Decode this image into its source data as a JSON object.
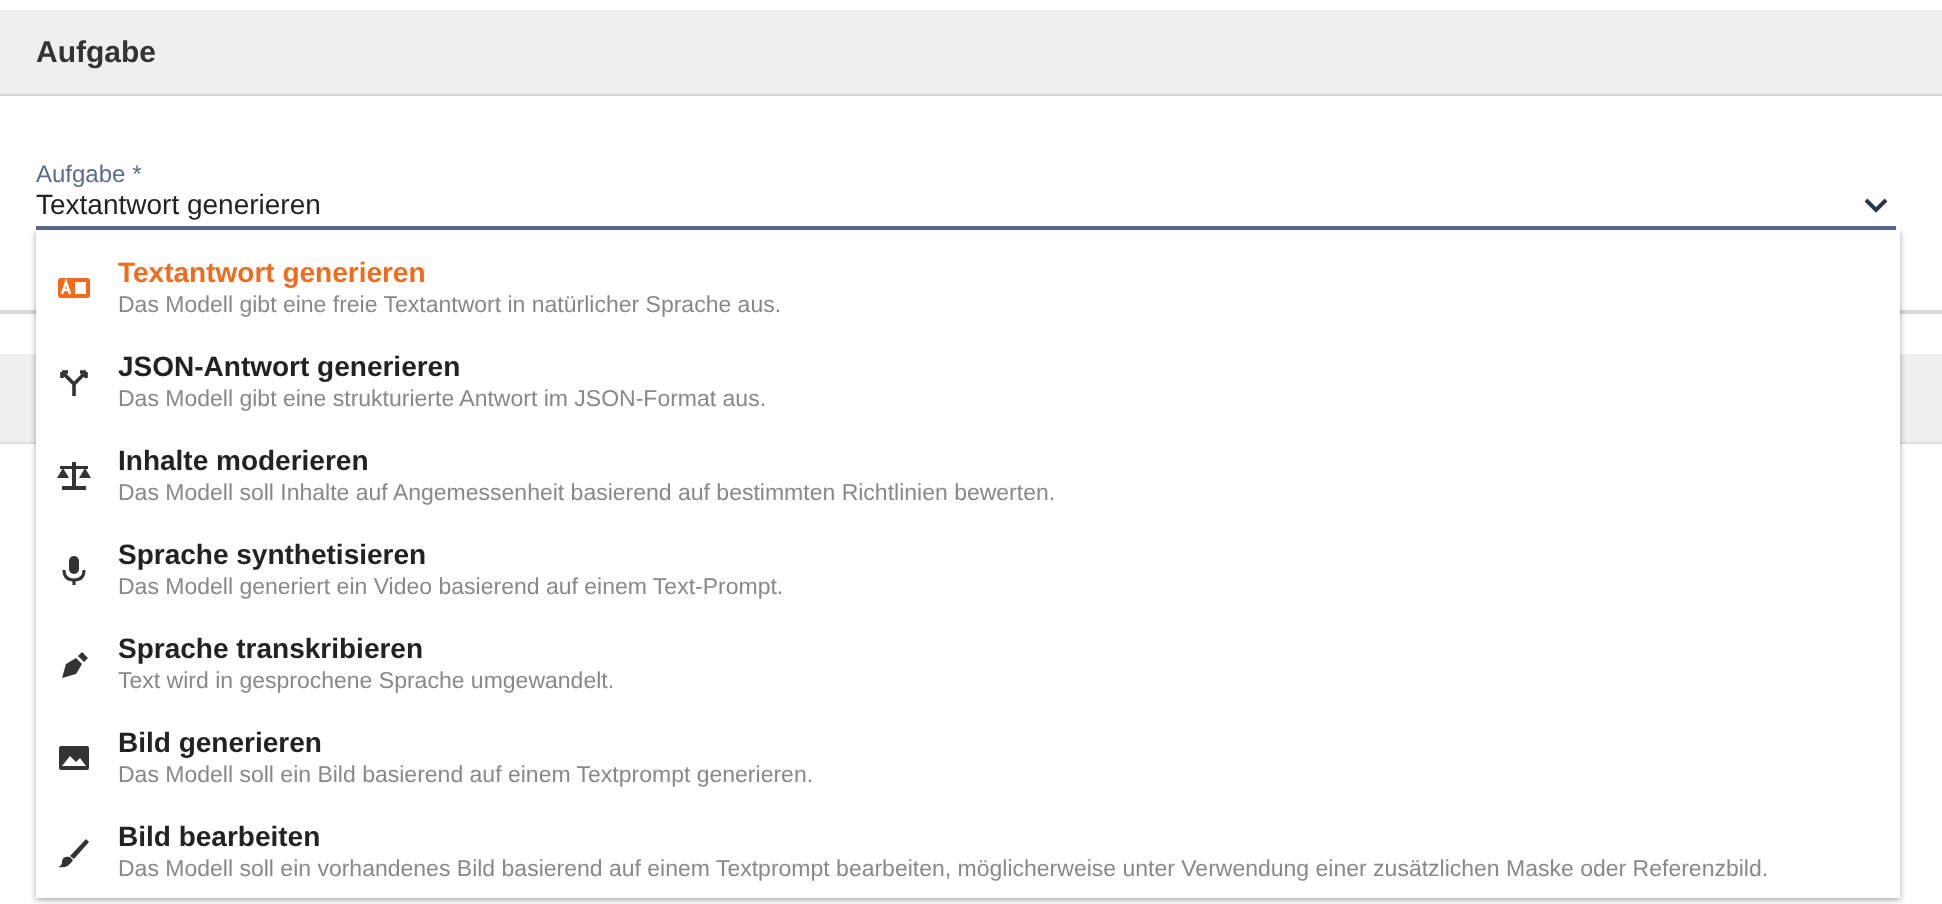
{
  "section": {
    "title": "Aufgabe"
  },
  "field": {
    "label": "Aufgabe",
    "required_mark": "*",
    "value": "Textantwort generieren",
    "expanded": true
  },
  "options": [
    {
      "title": "Textantwort generieren",
      "description": "Das Modell gibt eine freie Textantwort in natürlicher Sprache aus.",
      "selected": true
    },
    {
      "title": "JSON-Antwort generieren",
      "description": "Das Modell gibt eine strukturierte Antwort im JSON-Format aus.",
      "selected": false
    },
    {
      "title": "Inhalte moderieren",
      "description": "Das Modell soll Inhalte auf Angemessenheit basierend auf bestimmten Richtlinien bewerten.",
      "selected": false
    },
    {
      "title": "Sprache synthetisieren",
      "description": "Das Modell generiert ein Video basierend auf einem Text-Prompt.",
      "selected": false
    },
    {
      "title": "Sprache transkribieren",
      "description": "Text wird in gesprochene Sprache umgewandelt.",
      "selected": false
    },
    {
      "title": "Bild generieren",
      "description": "Das Modell soll ein Bild basierend auf einem Textprompt generieren.",
      "selected": false
    },
    {
      "title": "Bild bearbeiten",
      "description": "Das Modell soll ein vorhandenes Bild basierend auf einem Textprompt bearbeiten, möglicherweise unter Verwendung einer zusätzlichen Maske oder Referenzbild.",
      "selected": false
    }
  ]
}
